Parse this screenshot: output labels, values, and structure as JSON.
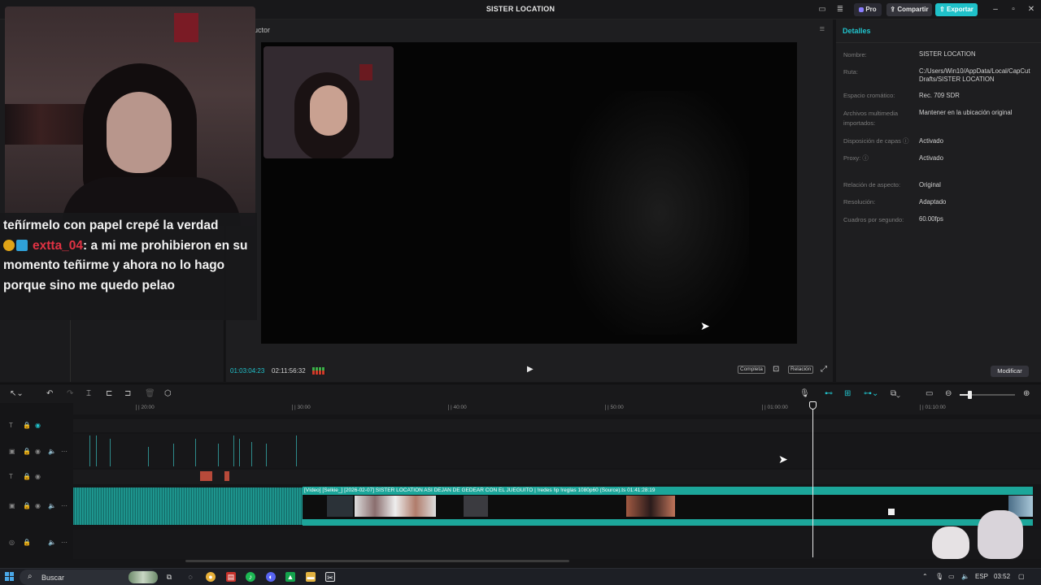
{
  "window": {
    "title": "SISTER LOCATION",
    "pro_label": "Pro",
    "share_label": "Compartir",
    "export_label": "Exportar"
  },
  "chat": {
    "messages": [
      {
        "user": "",
        "text": "teñírmelo con papel crepé la verdad"
      },
      {
        "user": "extta_04",
        "text": ": a mi me prohibieron en su momento teñirme y ahora no lo hago porque sino me quedo pelao"
      }
    ]
  },
  "player": {
    "title_partial": "uctor",
    "current_time": "01:03:04:23",
    "total_time": "02:11:56:32",
    "full_label": "Completa",
    "ratio_label": "Relación"
  },
  "details": {
    "header": "Detalles",
    "rows": [
      {
        "label": "Nombre:",
        "value": "SISTER LOCATION"
      },
      {
        "label": "Ruta:",
        "value": "C:/Users/Win10/AppData/Local/CapCut Drafts/SISTER LOCATION"
      },
      {
        "label": "Espacio cromático:",
        "value": "Rec. 709 SDR"
      },
      {
        "label": "Archivos multimedia importados:",
        "value": "Mantener en la ubicación original"
      },
      {
        "label": "Disposición de capas ⓘ",
        "value": "Activado"
      },
      {
        "label": "Proxy: ⓘ",
        "value": "Activado"
      },
      {
        "label": "Relación de aspecto:",
        "value": "Original"
      },
      {
        "label": "Resolución:",
        "value": "Adaptado"
      },
      {
        "label": "Cuadros por segundo:",
        "value": "60.00fps"
      }
    ],
    "modify_label": "Modificar"
  },
  "ruler": {
    "ticks": [
      "| 20:00",
      "| 30:00",
      "| 40:00",
      "| 50:00",
      "| 01:00:00",
      "| 01:10:00"
    ]
  },
  "timeline": {
    "clip_label": "[Vídeo] [Selkie_] [2026-02-07] SISTER LOCATION ASI DEJAN DE GEDEAR CON EL JUEGUITO  |  !redes !ip !reglas 1080p60 (Source).ts",
    "clip_duration": "01:41:28:19"
  },
  "taskbar": {
    "search_placeholder": "Buscar",
    "language": "ESP",
    "clock": "03:52"
  },
  "colors": {
    "accent": "#21c3cc",
    "export_button": "#1fc1c9",
    "clip_teal": "#1ca69a",
    "chat_user_red": "#e03243",
    "chat_user_blue": "#3d7bff"
  }
}
